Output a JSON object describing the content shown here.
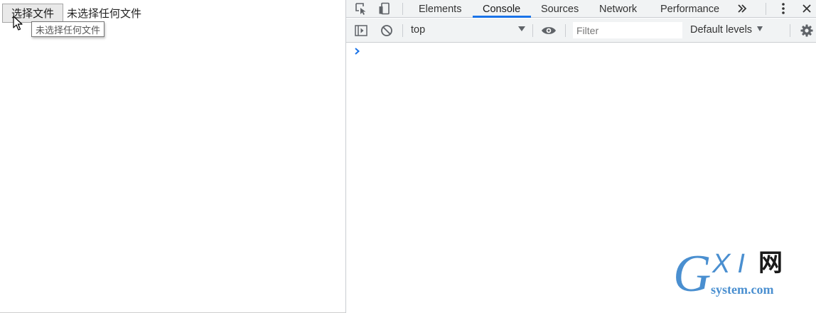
{
  "page": {
    "file_button_label": "选择文件",
    "file_status": "未选择任何文件",
    "tooltip": "未选择任何文件"
  },
  "devtools": {
    "tabs": [
      {
        "label": "Elements",
        "active": false
      },
      {
        "label": "Console",
        "active": true
      },
      {
        "label": "Sources",
        "active": false
      },
      {
        "label": "Network",
        "active": false
      },
      {
        "label": "Performance",
        "active": false
      }
    ],
    "more_tabs_icon": "double-chevron-right-icon",
    "toolbar": {
      "context": "top",
      "filter_placeholder": "Filter",
      "levels": "Default levels"
    },
    "accent_color": "#1a73e8"
  },
  "watermark": {
    "brand_g": "G",
    "brand_xi": "XI",
    "brand_wang": "网",
    "domain": "system.com",
    "color": "#4a8fd0"
  }
}
